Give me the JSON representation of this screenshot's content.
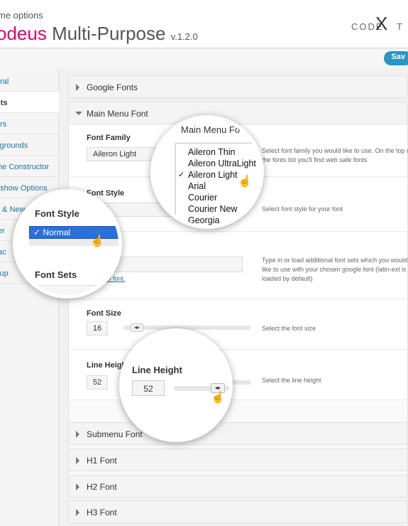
{
  "header": {
    "subtitle": "me options",
    "title_brand": "odeus",
    "title_rest": " Multi-Purpose ",
    "version": "v.1.2.0",
    "logo_left": "CODE",
    "logo_x": "X",
    "logo_right": "T"
  },
  "toolbar": {
    "save_label": "Sav"
  },
  "sidebar": {
    "items": [
      {
        "label": "eral"
      },
      {
        "label": "nts"
      },
      {
        "label": "ors"
      },
      {
        "label": "kgrounds"
      },
      {
        "label": "me Constructor"
      },
      {
        "label": "eshow Options"
      },
      {
        "label": "g & New"
      },
      {
        "label": "ter"
      },
      {
        "label": "tac"
      },
      {
        "label": "kup"
      }
    ]
  },
  "sections": {
    "google_fonts": "Google Fonts",
    "main_menu_font": "Main Menu Font",
    "submenu_font": "Submenu Font",
    "h1_font": "H1 Font",
    "h2_font": "H2 Font",
    "h3_font": "H3 Font"
  },
  "font_family": {
    "label": "Font Family",
    "value": "Aileron Light",
    "desc_line1": "Select font family you would like to use. On the top o",
    "desc_line2": "the fonts list you'll find web safe fonts"
  },
  "font_style": {
    "label": "Font Style",
    "value": "rmal",
    "desc": "Select font style for your font"
  },
  "font_sets": {
    "label": "Font Sets",
    "link": "m font.",
    "desc_line1": "Type in or load additional font sets which you would",
    "desc_line2": "like to use with your chosen google font (latin-ext is",
    "desc_line3": "loaded by default)"
  },
  "font_size": {
    "label": "Font Size",
    "value": "16",
    "desc": "Select the font size"
  },
  "line_height": {
    "label": "Line Heigh",
    "value": "52",
    "desc": "Select the line height"
  },
  "zoom_family": {
    "title": "Main Menu Fo",
    "options": [
      "Aileron Thin",
      "Aileron UltraLight",
      "Aileron Light",
      "Arial",
      "Courier",
      "Courier New",
      "Georgia"
    ],
    "selected": "Aileron Light"
  },
  "zoom_style": {
    "label": "Font Style",
    "selected": "Normal",
    "sets_label": "Font Sets"
  },
  "zoom_line": {
    "label": "Line Height",
    "value": "52"
  },
  "colors": {
    "accent": "#2a95c5",
    "brand": "#e4006b",
    "select_blue": "#2a6fdc"
  }
}
